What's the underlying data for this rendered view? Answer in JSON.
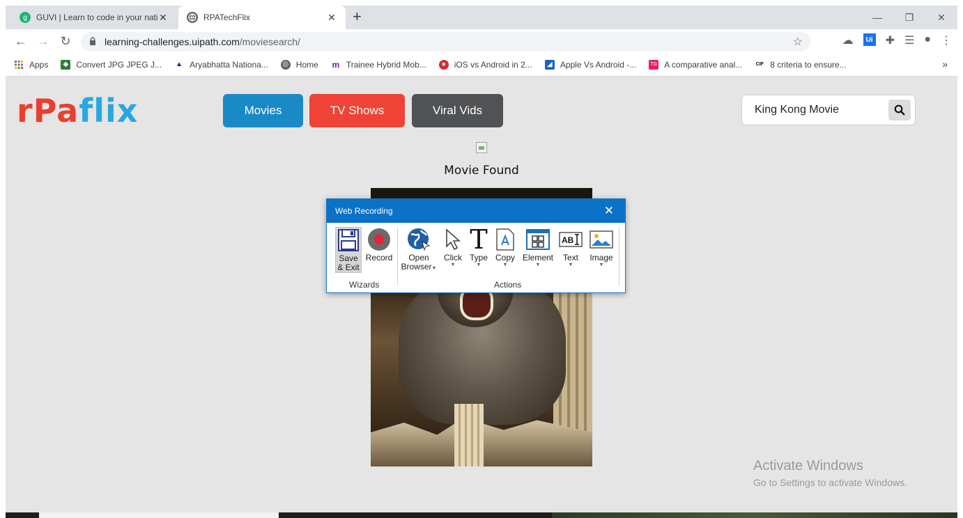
{
  "browser": {
    "tabs": [
      {
        "title": "GUVI | Learn to code in your nati",
        "favicon_color": "#22b573",
        "favicon_glyph": "g",
        "active": false
      },
      {
        "title": "RPATechFlix",
        "favicon_color": "#5f6368",
        "favicon_glyph": "globe",
        "active": true
      }
    ],
    "tab_close": "✕",
    "new_tab": "+",
    "window_controls": {
      "minimize": "—",
      "restore": "❐",
      "close": "✕"
    },
    "url_host": "learning-challenges.uipath.com",
    "url_path": "/moviesearch/",
    "ui_extension_label": "Ui",
    "bookmarks": [
      {
        "label": "Apps",
        "icon": "apps-grid-icon",
        "color": "#ea4335"
      },
      {
        "label": "Convert JPG JPEG J...",
        "icon": "shield-icon",
        "color": "#2e7d32"
      },
      {
        "label": "Aryabhatta Nationa...",
        "icon": "emblem-icon",
        "color": "#1a237e"
      },
      {
        "label": "Home",
        "icon": "globe-icon",
        "color": "#5f6368"
      },
      {
        "label": "Trainee Hybrid Mob...",
        "icon": "m-icon",
        "color": "#6a1b9a"
      },
      {
        "label": "iOS vs Android in 2...",
        "icon": "target-icon",
        "color": "#d32f2f"
      },
      {
        "label": "Apple Vs Android -...",
        "icon": "chart-flag-icon",
        "color": "#1565c0"
      },
      {
        "label": "A comparative anal...",
        "icon": "tg-icon",
        "color": "#e91e63"
      },
      {
        "label": "8 criteria to ensure...",
        "icon": "cif-icon",
        "color": "#000000"
      }
    ],
    "bookmarks_overflow": "»"
  },
  "page": {
    "logo": {
      "part1": "r",
      "part2": "Pa",
      "part3": "flix"
    },
    "nav": {
      "movies": "Movies",
      "tv_shows": "TV Shows",
      "viral_vids": "Viral Vids"
    },
    "search_value": "King Kong Movie",
    "result_heading": "Movie Found",
    "watermark": {
      "line1": "Activate Windows",
      "line2": "Go to Settings to activate Windows."
    }
  },
  "recorder": {
    "title": "Web Recording",
    "close": "✕",
    "wizards": {
      "save_exit_line1": "Save",
      "save_exit_line2": "& Exit",
      "record": "Record",
      "group_label": "Wizards"
    },
    "actions": {
      "open_browser_line1": "Open",
      "open_browser_line2": "Browser",
      "click": "Click",
      "type": "Type",
      "copy": "Copy",
      "element": "Element",
      "text": "Text",
      "image": "Image",
      "group_label": "Actions"
    }
  },
  "colors": {
    "movies_btn": "#1a8ac7",
    "tv_btn": "#ee4336",
    "viral_btn": "#505254",
    "recorder_header": "#0b72c8",
    "page_bg": "#e5e5e5"
  }
}
